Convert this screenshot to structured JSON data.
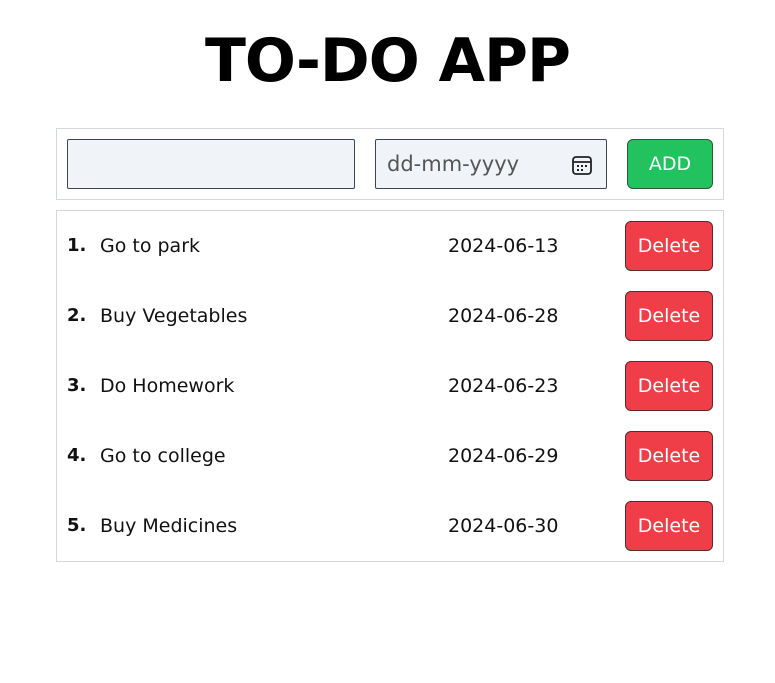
{
  "app": {
    "title": "TO-DO APP"
  },
  "form": {
    "task_value": "",
    "date_placeholder": "dd-mm-yyyy",
    "add_label": "ADD",
    "calendar_icon": "calendar-icon"
  },
  "todos": [
    {
      "num": "1.",
      "text": "Go to park",
      "date": "2024-06-13",
      "delete_label": "Delete"
    },
    {
      "num": "2.",
      "text": "Buy Vegetables",
      "date": "2024-06-28",
      "delete_label": "Delete"
    },
    {
      "num": "3.",
      "text": "Do Homework",
      "date": "2024-06-23",
      "delete_label": "Delete"
    },
    {
      "num": "4.",
      "text": "Go to college",
      "date": "2024-06-29",
      "delete_label": "Delete"
    },
    {
      "num": "5.",
      "text": "Buy Medicines",
      "date": "2024-06-30",
      "delete_label": "Delete"
    }
  ],
  "colors": {
    "add_button": "#22c35e",
    "delete_button": "#ef3e47",
    "input_bg": "#f0f3f8"
  }
}
